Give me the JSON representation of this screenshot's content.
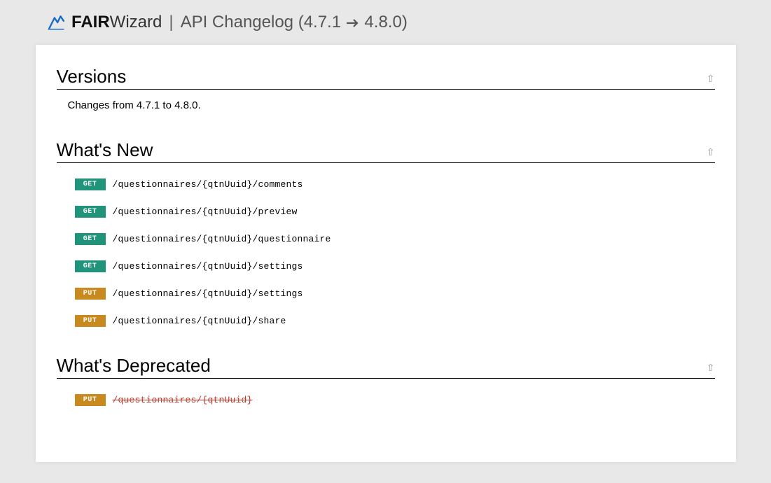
{
  "header": {
    "brand_fair": "FAIR",
    "brand_wizard": "Wizard",
    "separator": "|",
    "title_prefix": "API Changelog (",
    "version_from": "4.7.1",
    "version_to": "4.8.0",
    "title_suffix": ")"
  },
  "sections": {
    "versions": {
      "title": "Versions",
      "description": "Changes from 4.7.1 to 4.8.0."
    },
    "whats_new": {
      "title": "What's New",
      "endpoints": [
        {
          "method": "GET",
          "path": "/questionnaires/{qtnUuid}/comments"
        },
        {
          "method": "GET",
          "path": "/questionnaires/{qtnUuid}/preview"
        },
        {
          "method": "GET",
          "path": "/questionnaires/{qtnUuid}/questionnaire"
        },
        {
          "method": "GET",
          "path": "/questionnaires/{qtnUuid}/settings"
        },
        {
          "method": "PUT",
          "path": "/questionnaires/{qtnUuid}/settings"
        },
        {
          "method": "PUT",
          "path": "/questionnaires/{qtnUuid}/share"
        }
      ]
    },
    "whats_deprecated": {
      "title": "What's Deprecated",
      "endpoints": [
        {
          "method": "PUT",
          "path": "/questionnaires/{qtnUuid}"
        }
      ]
    }
  },
  "ui": {
    "to_top_glyph": "⇧"
  },
  "colors": {
    "get": "#1f947a",
    "put": "#c8891f",
    "deprecated": "#c0392b"
  }
}
